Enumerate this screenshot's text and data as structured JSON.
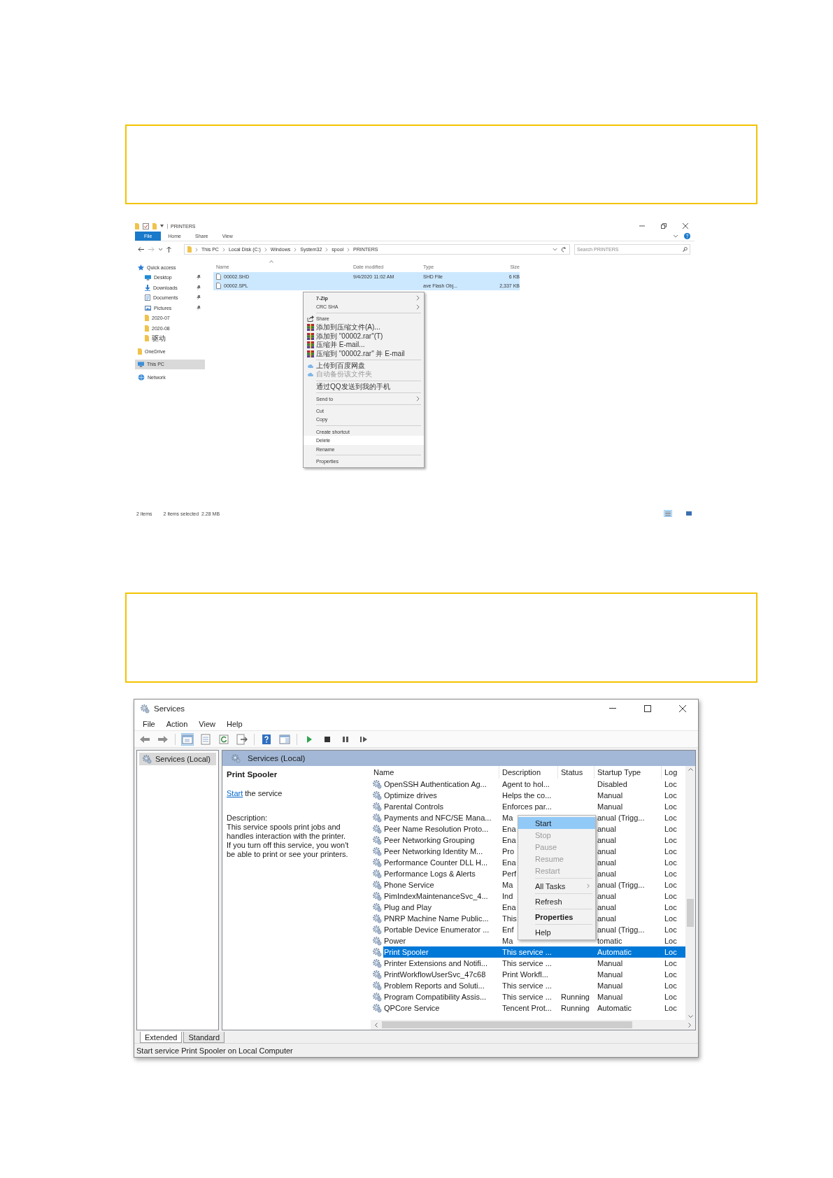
{
  "explorer": {
    "title": "PRINTERS",
    "ribbon_tabs": [
      {
        "label": "File",
        "selected": true
      },
      {
        "label": "Home",
        "selected": false
      },
      {
        "label": "Share",
        "selected": false
      },
      {
        "label": "View",
        "selected": false
      }
    ],
    "breadcrumb": [
      "This PC",
      "Local Disk (C:)",
      "Windows",
      "System32",
      "spool",
      "PRINTERS"
    ],
    "search": {
      "placeholder": "Search PRINTERS"
    },
    "nav": [
      {
        "label": "Quick access",
        "kind": "star",
        "pinned": false,
        "selected": false,
        "children": [
          {
            "label": "Desktop",
            "kind": "desktop",
            "pinned": true,
            "selected": false
          },
          {
            "label": "Downloads",
            "kind": "download",
            "pinned": true,
            "selected": false
          },
          {
            "label": "Documents",
            "kind": "documents",
            "pinned": true,
            "selected": false
          },
          {
            "label": "Pictures",
            "kind": "pictures",
            "pinned": true,
            "selected": false
          },
          {
            "label": "2020-07",
            "kind": "folder",
            "pinned": false,
            "selected": false
          },
          {
            "label": "2020-08",
            "kind": "folder",
            "pinned": false,
            "selected": false
          },
          {
            "label": "驱动",
            "kind": "folder",
            "pinned": false,
            "selected": false
          }
        ]
      },
      {
        "label": "OneDrive",
        "kind": "folder",
        "pinned": false,
        "selected": false
      },
      {
        "label": "This PC",
        "kind": "pc",
        "pinned": false,
        "selected": true
      },
      {
        "label": "Network",
        "kind": "network",
        "pinned": false,
        "selected": false
      }
    ],
    "columns": [
      "Name",
      "Date modified",
      "Type",
      "Size"
    ],
    "files": [
      {
        "name": "00002.SHD",
        "date": "9/4/2020 11:02 AM",
        "type": "SHD File",
        "size": "6 KB",
        "selected": true
      },
      {
        "name": "00002.SPL",
        "type": "ave Flash Obj...",
        "size": "2,337 KB",
        "selected": true
      }
    ],
    "context_menu": [
      [
        {
          "label": "7-Zip",
          "kind": "plain",
          "bold": true,
          "disabled": false,
          "submenu": true,
          "selected": false
        },
        {
          "label": "CRC SHA",
          "kind": "plain",
          "bold": false,
          "disabled": false,
          "submenu": true,
          "selected": false
        }
      ],
      [
        {
          "label": "Share",
          "kind": "share",
          "bold": false,
          "disabled": false,
          "submenu": false,
          "selected": false
        },
        {
          "label": "添加到压缩文件(A)...",
          "kind": "archive",
          "bold": false,
          "disabled": false,
          "submenu": false,
          "selected": false
        },
        {
          "label": "添加到 \"00002.rar\"(T)",
          "kind": "archive",
          "bold": false,
          "disabled": false,
          "submenu": false,
          "selected": false
        },
        {
          "label": "压缩并 E-mail...",
          "kind": "archive",
          "bold": false,
          "disabled": false,
          "submenu": false,
          "selected": false
        },
        {
          "label": "压缩到 \"00002.rar\" 并 E-mail",
          "kind": "archive",
          "bold": false,
          "disabled": false,
          "submenu": false,
          "selected": false
        }
      ],
      [
        {
          "label": "上传到百度网盘",
          "kind": "cloud",
          "bold": false,
          "disabled": false,
          "submenu": false,
          "selected": false
        },
        {
          "label": "自动备份该文件夹",
          "kind": "cloud",
          "bold": false,
          "disabled": true,
          "submenu": false,
          "selected": false
        }
      ],
      [
        {
          "label": "通过QQ发送到我的手机",
          "kind": "plain",
          "bold": false,
          "disabled": false,
          "submenu": false,
          "selected": false
        }
      ],
      [
        {
          "label": "Send to",
          "kind": "plain",
          "bold": false,
          "disabled": false,
          "submenu": true,
          "selected": false
        }
      ],
      [
        {
          "label": "Cut",
          "kind": "plain",
          "bold": false,
          "disabled": false,
          "submenu": false,
          "selected": false
        },
        {
          "label": "Copy",
          "kind": "plain",
          "bold": false,
          "disabled": false,
          "submenu": false,
          "selected": false
        }
      ],
      [
        {
          "label": "Create shortcut",
          "kind": "plain",
          "bold": false,
          "disabled": false,
          "submenu": false,
          "selected": false
        },
        {
          "label": "Delete",
          "kind": "plain",
          "bold": false,
          "disabled": false,
          "submenu": false,
          "selected": true
        },
        {
          "label": "Rename",
          "kind": "plain",
          "bold": false,
          "disabled": false,
          "submenu": false,
          "selected": false
        }
      ],
      [
        {
          "label": "Properties",
          "kind": "plain",
          "bold": false,
          "disabled": false,
          "submenu": false,
          "selected": false
        }
      ]
    ],
    "status": {
      "count": "2 items",
      "selection": "2 items selected  2.28 MB"
    },
    "views": [
      {
        "kind": "details",
        "selected": true
      },
      {
        "kind": "tiles",
        "selected": false
      }
    ]
  },
  "services": {
    "title": "Services",
    "menu_bar": [
      "File",
      "Action",
      "View",
      "Help"
    ],
    "tree": [
      {
        "label": "Services (Local)",
        "selected": true
      }
    ],
    "header": "Services (Local)",
    "detail": {
      "title": "Print Spooler",
      "link": "Start",
      "link_rest": "the service",
      "description_label": "Description:",
      "description": "This service spools print jobs and handles interaction with the printer. If you turn off this service, you won't be able to print or see your printers."
    },
    "columns": [
      "Name",
      "Description",
      "Status",
      "Startup Type",
      "Log"
    ],
    "rows": [
      {
        "name": "OpenSSH Authentication Ag...",
        "description": "Agent to hol...",
        "status": "",
        "startup": "Disabled",
        "log": "Loc",
        "selected": false
      },
      {
        "name": "Optimize drives",
        "description": "Helps the co...",
        "status": "",
        "startup": "Manual",
        "log": "Loc",
        "selected": false
      },
      {
        "name": "Parental Controls",
        "description": "Enforces par...",
        "status": "",
        "startup": "Manual",
        "log": "Loc",
        "selected": false
      },
      {
        "name": "Payments and NFC/SE Mana...",
        "description": "Ma",
        "status": "",
        "startup": "anual (Trigg...",
        "log": "Loc",
        "selected": false
      },
      {
        "name": "Peer Name Resolution Proto...",
        "description": "Ena",
        "status": "",
        "startup": "anual",
        "log": "Loc",
        "selected": false
      },
      {
        "name": "Peer Networking Grouping",
        "description": "Ena",
        "status": "",
        "startup": "anual",
        "log": "Loc",
        "selected": false
      },
      {
        "name": "Peer Networking Identity M...",
        "description": "Pro",
        "status": "",
        "startup": "anual",
        "log": "Loc",
        "selected": false
      },
      {
        "name": "Performance Counter DLL H...",
        "description": "Ena",
        "status": "",
        "startup": "anual",
        "log": "Loc",
        "selected": false
      },
      {
        "name": "Performance Logs & Alerts",
        "description": "Perf",
        "status": "",
        "startup": "anual",
        "log": "Loc",
        "selected": false
      },
      {
        "name": "Phone Service",
        "description": "Ma",
        "status": "",
        "startup": "anual (Trigg...",
        "log": "Loc",
        "selected": false
      },
      {
        "name": "PimIndexMaintenanceSvc_4...",
        "description": "Ind",
        "status": "",
        "startup": "anual",
        "log": "Loc",
        "selected": false
      },
      {
        "name": "Plug and Play",
        "description": "Ena",
        "status": "",
        "startup": "anual",
        "log": "Loc",
        "selected": false
      },
      {
        "name": "PNRP Machine Name Public...",
        "description": "This",
        "status": "",
        "startup": "anual",
        "log": "Loc",
        "selected": false
      },
      {
        "name": "Portable Device Enumerator ...",
        "description": "Enf",
        "status": "",
        "startup": "anual (Trigg...",
        "log": "Loc",
        "selected": false
      },
      {
        "name": "Power",
        "description": "Ma",
        "status": "",
        "startup": "tomatic",
        "log": "Loc",
        "selected": false
      },
      {
        "name": "Print Spooler",
        "description": "This service ...",
        "status": "",
        "startup": "Automatic",
        "log": "Loc",
        "selected": true
      },
      {
        "name": "Printer Extensions and Notifi...",
        "description": "This service ...",
        "status": "",
        "startup": "Manual",
        "log": "Loc",
        "selected": false
      },
      {
        "name": "PrintWorkflowUserSvc_47c68",
        "description": "Print Workfl...",
        "status": "",
        "startup": "Manual",
        "log": "Loc",
        "selected": false
      },
      {
        "name": "Problem Reports and Soluti...",
        "description": "This service ...",
        "status": "",
        "startup": "Manual",
        "log": "Loc",
        "selected": false
      },
      {
        "name": "Program Compatibility Assis...",
        "description": "This service ...",
        "status": "Running",
        "startup": "Manual",
        "log": "Loc",
        "selected": false
      },
      {
        "name": "QPCore Service",
        "description": "Tencent Prot...",
        "status": "Running",
        "startup": "Automatic",
        "log": "Loc",
        "selected": false
      }
    ],
    "context_menu": [
      [
        {
          "label": "Start",
          "bold": false,
          "disabled": false,
          "submenu": false,
          "selected": true
        },
        {
          "label": "Stop",
          "bold": false,
          "disabled": true,
          "submenu": false,
          "selected": false
        },
        {
          "label": "Pause",
          "bold": false,
          "disabled": true,
          "submenu": false,
          "selected": false
        },
        {
          "label": "Resume",
          "bold": false,
          "disabled": true,
          "submenu": false,
          "selected": false
        },
        {
          "label": "Restart",
          "bold": false,
          "disabled": true,
          "submenu": false,
          "selected": false
        }
      ],
      [
        {
          "label": "All Tasks",
          "bold": false,
          "disabled": false,
          "submenu": true,
          "selected": false
        }
      ],
      [
        {
          "label": "Refresh",
          "bold": false,
          "disabled": false,
          "submenu": false,
          "selected": false
        }
      ],
      [
        {
          "label": "Properties",
          "bold": true,
          "disabled": false,
          "submenu": false,
          "selected": false
        }
      ],
      [
        {
          "label": "Help",
          "bold": false,
          "disabled": false,
          "submenu": false,
          "selected": false
        }
      ]
    ],
    "view_tabs": [
      {
        "label": "Extended",
        "selected": true
      },
      {
        "label": "Standard",
        "selected": false
      }
    ],
    "status_bar": "Start service Print Spooler on Local Computer"
  }
}
